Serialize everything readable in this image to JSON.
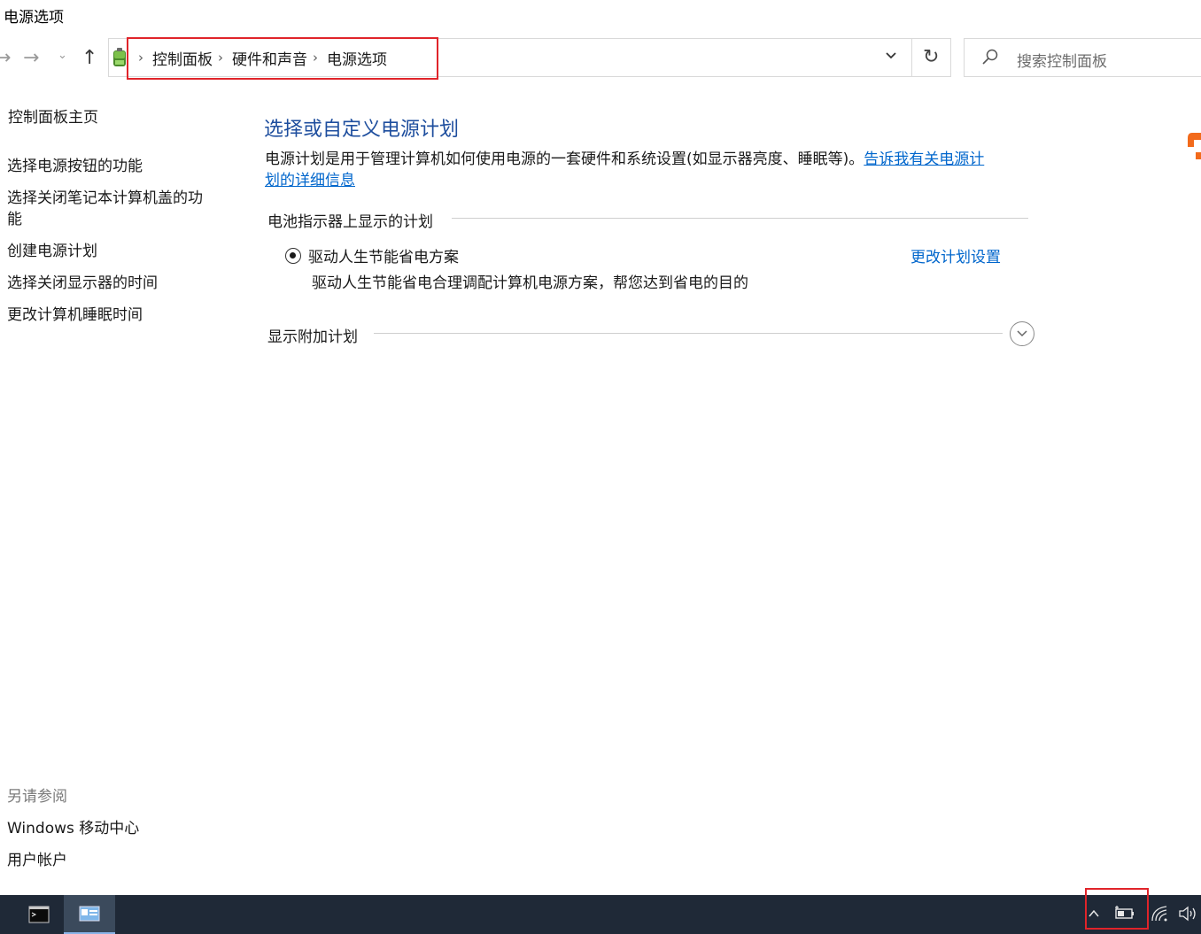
{
  "window": {
    "title": "电源选项"
  },
  "nav": {
    "back_icon": "back-arrow-icon",
    "forward_icon": "forward-arrow-icon",
    "recent_icon": "chevron-down-icon",
    "up_icon": "up-arrow-icon"
  },
  "address": {
    "breadcrumbs": [
      "控制面板",
      "硬件和声音",
      "电源选项"
    ],
    "sep": "›"
  },
  "search": {
    "placeholder": "搜索控制面板"
  },
  "sidebar": {
    "home": "控制面板主页",
    "links": [
      "选择电源按钮的功能",
      "选择关闭笔记本计算机盖的功",
      "能",
      "创建电源计划",
      "选择关闭显示器的时间",
      "更改计算机睡眠时间"
    ],
    "see_also_title": "另请参阅",
    "see_also": [
      "Windows 移动中心",
      "用户帐户"
    ]
  },
  "main": {
    "title": "选择或自定义电源计划",
    "description_line1": "电源计划是用于管理计算机如何使用电源的一套硬件和系统设置(如显示器亮度、睡眠等)。",
    "description_link1": "告诉我有关电源计",
    "description_link2": "划的详细信息",
    "battery_section": "电池指示器上显示的计划",
    "plan_name": "驱动人生节能省电方案",
    "plan_description": "驱动人生节能省电合理调配计算机电源方案，帮您达到省电的目的",
    "change_plan_link": "更改计划设置",
    "extra_section": "显示附加计划"
  },
  "colors": {
    "link": "#0066cc",
    "title": "#1e4e9e",
    "highlight": "#e0242a",
    "taskbar": "#1f2937"
  }
}
